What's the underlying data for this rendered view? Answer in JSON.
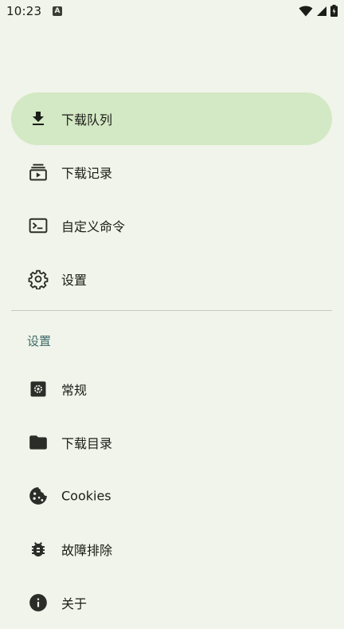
{
  "status_bar": {
    "time": "10:23",
    "badge": "A"
  },
  "nav": {
    "items": [
      {
        "label": "下载队列",
        "icon": "download-icon",
        "active": true
      },
      {
        "label": "下载记录",
        "icon": "history-icon",
        "active": false
      },
      {
        "label": "自定义命令",
        "icon": "terminal-icon",
        "active": false
      },
      {
        "label": "设置",
        "icon": "gear-icon",
        "active": false
      }
    ]
  },
  "settings_section": {
    "header": "设置",
    "items": [
      {
        "label": "常规",
        "icon": "general-settings-icon"
      },
      {
        "label": "下载目录",
        "icon": "folder-icon"
      },
      {
        "label": "Cookies",
        "icon": "cookie-icon"
      },
      {
        "label": "故障排除",
        "icon": "bug-icon"
      },
      {
        "label": "关于",
        "icon": "info-icon"
      }
    ]
  },
  "colors": {
    "background": "#f1f4ea",
    "active_item": "#d3e8c4",
    "section_header": "#3d6a6a",
    "icon": "#2b2e28"
  }
}
